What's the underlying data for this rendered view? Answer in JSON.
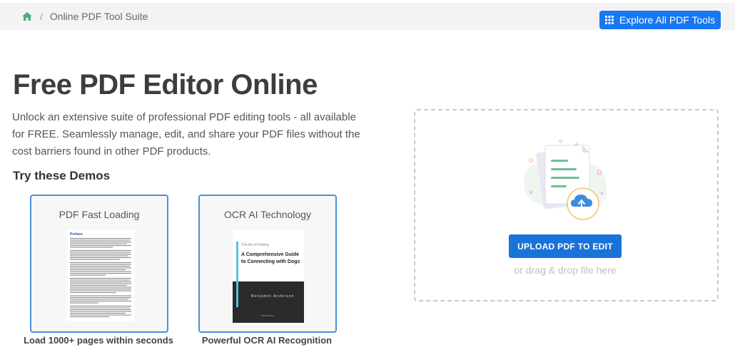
{
  "breadcrumb": {
    "current": "Online PDF Tool Suite",
    "separator": "/"
  },
  "toolbar": {
    "explore_label": "Explore All PDF Tools"
  },
  "main": {
    "title": "Free PDF Editor Online",
    "description": "Unlock an extensive suite of professional PDF editing tools - all available for FREE. Seamlessly manage, edit, and share your PDF files without the cost barriers found in other PDF products.",
    "demos_heading": "Try these Demos"
  },
  "demos": [
    {
      "label": "PDF Fast Loading",
      "caption": "Load 1000+ pages within seconds",
      "thumb_heading": "Preface"
    },
    {
      "label": "OCR AI Technology",
      "caption": "Powerful OCR AI Recognition",
      "book": {
        "small": "The Art of Petting",
        "title": "A Comprehensive Guide to Connecting with Dogs",
        "author": "Benjamin Anderson",
        "publisher": "PRINCETON"
      }
    }
  ],
  "upload": {
    "button_label": "UPLOAD PDF TO EDIT",
    "drag_text": "or drag & drop file here"
  },
  "colors": {
    "accent": "#1877f2",
    "upload_button": "#1a73d9",
    "home_icon": "#4caf7d",
    "card_border": "#4a90d9"
  },
  "icons": {
    "home": "home-icon",
    "grid": "grid-icon",
    "upload": "cloud-upload-icon"
  }
}
